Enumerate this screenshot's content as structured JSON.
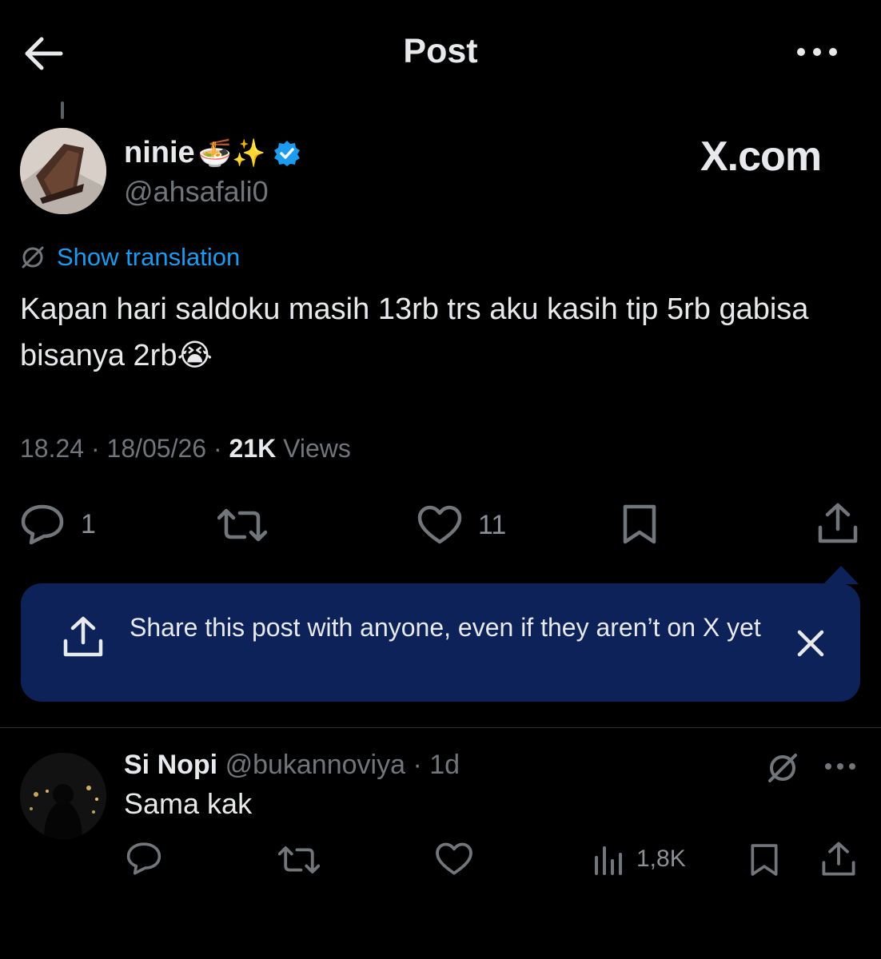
{
  "header": {
    "title": "Post"
  },
  "post": {
    "display_name": "ninie",
    "name_emojis": "🍜✨",
    "handle": "@ahsafali0",
    "watermark": "X.com",
    "translate_label": "Show translation",
    "text": "Kapan hari saldoku masih 13rb trs aku kasih tip 5rb gabisa bisanya 2rb😭",
    "time": "18.24",
    "date": "18/05/26",
    "views_count": "21K",
    "views_label": "Views",
    "reply_count": "1",
    "like_count": "11"
  },
  "share_banner": {
    "text": "Share this post with anyone, even if they aren’t on X yet"
  },
  "reply": {
    "display_name": "Si Nopi",
    "handle": "@bukannoviya",
    "age": "1d",
    "text": "Sama kak",
    "views": "1,8K"
  },
  "colors": {
    "background": "#000000",
    "accent": "#1d9bf0",
    "banner": "#0c2258",
    "muted": "#71767b"
  }
}
